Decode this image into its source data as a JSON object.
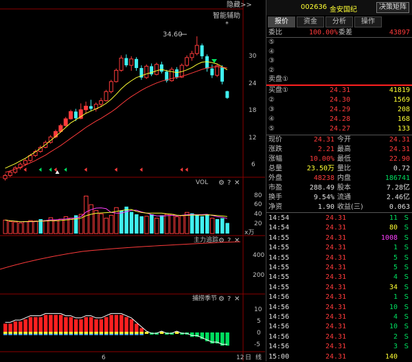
{
  "chart": {
    "top_button": "隐藏>>",
    "annotation": "智能辅助",
    "annotation_star": "*",
    "price_high_label": "34.60",
    "price_axis": [
      "30",
      "24",
      "18",
      "12",
      "6"
    ],
    "vol_title": "VOL",
    "vol_axis": [
      "80",
      "60",
      "40",
      "20"
    ],
    "vol_unit": "x万",
    "main_title": "主力追踪",
    "main_axis": [
      "400",
      "200"
    ],
    "season_title": "捕捞季节",
    "season_axis": [
      "10",
      "5",
      "0",
      "-5"
    ],
    "bottom_left_label": "6",
    "bottom_right_label": "12",
    "period_day": "日",
    "period_line": "线",
    "candles": [
      {
        "o": 3.2,
        "c": 3.9,
        "h": 4.3,
        "l": 2.8
      },
      {
        "o": 3.9,
        "c": 4.6,
        "h": 5.0,
        "l": 3.6
      },
      {
        "o": 4.6,
        "c": 5.6,
        "h": 6.0,
        "l": 4.3
      },
      {
        "o": 5.6,
        "c": 6.4,
        "h": 6.8,
        "l": 5.2
      },
      {
        "o": 6.4,
        "c": 7.2,
        "h": 7.6,
        "l": 6.0
      },
      {
        "o": 7.2,
        "c": 8.3,
        "h": 8.7,
        "l": 6.9
      },
      {
        "o": 8.3,
        "c": 9.2,
        "h": 9.6,
        "l": 8.0
      },
      {
        "o": 9.2,
        "c": 10.1,
        "h": 10.5,
        "l": 8.9
      },
      {
        "o": 10.1,
        "c": 11.2,
        "h": 11.6,
        "l": 9.9
      },
      {
        "o": 11.2,
        "c": 12.4,
        "h": 12.8,
        "l": 10.9
      },
      {
        "o": 12.4,
        "c": 13.6,
        "h": 14.0,
        "l": 12.1
      },
      {
        "o": 13.6,
        "c": 14.9,
        "h": 15.3,
        "l": 13.3
      },
      {
        "o": 14.9,
        "c": 16.4,
        "h": 16.8,
        "l": 14.7
      },
      {
        "o": 16.4,
        "c": 18.0,
        "h": 18.4,
        "l": 16.2
      },
      {
        "o": 18.0,
        "c": 16.5,
        "h": 18.6,
        "l": 15.9
      },
      {
        "o": 16.5,
        "c": 18.4,
        "h": 19.8,
        "l": 16.3
      },
      {
        "o": 18.4,
        "c": 19.2,
        "h": 20.2,
        "l": 17.6
      },
      {
        "o": 19.2,
        "c": 18.6,
        "h": 20.6,
        "l": 18.2
      },
      {
        "o": 18.6,
        "c": 19.6,
        "h": 20.0,
        "l": 18.0
      },
      {
        "o": 19.6,
        "c": 20.4,
        "h": 21.0,
        "l": 19.0
      },
      {
        "o": 20.4,
        "c": 22.4,
        "h": 22.8,
        "l": 20.2
      },
      {
        "o": 22.4,
        "c": 24.6,
        "h": 25.0,
        "l": 22.0
      },
      {
        "o": 24.6,
        "c": 27.1,
        "h": 27.5,
        "l": 24.4
      },
      {
        "o": 27.1,
        "c": 29.8,
        "h": 30.4,
        "l": 26.8
      },
      {
        "o": 29.8,
        "c": 28.2,
        "h": 30.6,
        "l": 27.8
      },
      {
        "o": 28.2,
        "c": 29.6,
        "h": 30.2,
        "l": 27.0
      },
      {
        "o": 29.6,
        "c": 27.6,
        "h": 30.0,
        "l": 27.0
      },
      {
        "o": 27.6,
        "c": 25.5,
        "h": 28.2,
        "l": 25.0
      },
      {
        "o": 25.5,
        "c": 28.0,
        "h": 28.4,
        "l": 25.2
      },
      {
        "o": 28.0,
        "c": 26.2,
        "h": 28.6,
        "l": 25.8
      },
      {
        "o": 26.2,
        "c": 28.4,
        "h": 28.8,
        "l": 26.0
      },
      {
        "o": 28.4,
        "c": 26.8,
        "h": 29.0,
        "l": 26.4
      },
      {
        "o": 26.8,
        "c": 24.8,
        "h": 27.2,
        "l": 24.4
      },
      {
        "o": 24.8,
        "c": 27.3,
        "h": 27.8,
        "l": 24.6
      },
      {
        "o": 27.3,
        "c": 25.6,
        "h": 27.8,
        "l": 25.2
      },
      {
        "o": 25.6,
        "c": 28.2,
        "h": 28.6,
        "l": 25.4
      },
      {
        "o": 28.2,
        "c": 29.9,
        "h": 30.4,
        "l": 27.9
      },
      {
        "o": 29.9,
        "c": 30.8,
        "h": 31.4,
        "l": 29.2
      },
      {
        "o": 30.8,
        "c": 32.6,
        "h": 34.6,
        "l": 30.4
      },
      {
        "o": 32.6,
        "c": 30.2,
        "h": 33.0,
        "l": 29.6
      },
      {
        "o": 30.2,
        "c": 27.5,
        "h": 30.6,
        "l": 26.8
      },
      {
        "o": 27.5,
        "c": 26.0,
        "h": 28.4,
        "l": 25.4
      },
      {
        "o": 26.0,
        "c": 28.1,
        "h": 28.6,
        "l": 25.6
      },
      {
        "o": 27.8,
        "c": 24.6,
        "h": 28.2,
        "l": 24.0
      },
      {
        "o": 22.5,
        "c": 21.0,
        "h": 22.6,
        "l": 20.8
      }
    ],
    "ma": [
      [
        5.5,
        6.0,
        6.5,
        7.1,
        7.7,
        8.4,
        9.1,
        9.9,
        10.7,
        11.6,
        12.5,
        13.5,
        14.5,
        15.5,
        16.2,
        16.9,
        17.6,
        18.1,
        18.6,
        19.1,
        19.8,
        20.7,
        21.8,
        23.0,
        24.0,
        24.8,
        25.5,
        25.9,
        26.3,
        26.6,
        27.0,
        27.3,
        27.0,
        26.8,
        26.6,
        26.8,
        27.2,
        27.7,
        28.4,
        28.9,
        29.0,
        28.8,
        28.5,
        27.9,
        27.2
      ],
      [
        4.6,
        4.9,
        5.3,
        5.7,
        6.2,
        6.7,
        7.2,
        7.8,
        8.4,
        9.1,
        9.8,
        10.5,
        11.3,
        12.1,
        12.9,
        13.7,
        14.5,
        15.2,
        15.9,
        16.5,
        17.2,
        17.9,
        18.7,
        19.6,
        20.5,
        21.3,
        22.0,
        22.7,
        23.3,
        23.8,
        24.3,
        24.7,
        25.0,
        25.3,
        25.5,
        25.8,
        26.1,
        26.5,
        26.9,
        27.3,
        27.6,
        27.8,
        27.9,
        27.8,
        27.6
      ]
    ],
    "volumes": [
      {
        "v": 28,
        "up": true
      },
      {
        "v": 25,
        "up": true
      },
      {
        "v": 24,
        "up": true
      },
      {
        "v": 22,
        "up": true
      },
      {
        "v": 25,
        "up": true
      },
      {
        "v": 27,
        "up": true
      },
      {
        "v": 26,
        "up": true
      },
      {
        "v": 30,
        "up": false
      },
      {
        "v": 27,
        "up": true
      },
      {
        "v": 33,
        "up": true
      },
      {
        "v": 27,
        "up": true
      },
      {
        "v": 30,
        "up": true
      },
      {
        "v": 35,
        "up": true
      },
      {
        "v": 32,
        "up": true
      },
      {
        "v": 38,
        "up": false
      },
      {
        "v": 40,
        "up": true
      },
      {
        "v": 78,
        "up": true
      },
      {
        "v": 60,
        "up": true
      },
      {
        "v": 48,
        "up": true
      },
      {
        "v": 41,
        "up": true
      },
      {
        "v": 32,
        "up": true
      },
      {
        "v": 38,
        "up": true
      },
      {
        "v": 54,
        "up": true
      },
      {
        "v": 48,
        "up": false
      },
      {
        "v": 56,
        "up": false
      },
      {
        "v": 45,
        "up": false
      },
      {
        "v": 40,
        "up": false
      },
      {
        "v": 36,
        "up": false
      },
      {
        "v": 36,
        "up": true
      },
      {
        "v": 40,
        "up": false
      },
      {
        "v": 32,
        "up": true
      },
      {
        "v": 38,
        "up": false
      },
      {
        "v": 40,
        "up": true
      },
      {
        "v": 40,
        "up": true
      },
      {
        "v": 35,
        "up": true
      },
      {
        "v": 37,
        "up": true
      },
      {
        "v": 44,
        "up": true
      },
      {
        "v": 42,
        "up": false
      },
      {
        "v": 38,
        "up": false
      },
      {
        "v": 36,
        "up": false
      },
      {
        "v": 40,
        "up": false
      },
      {
        "v": 32,
        "up": true
      },
      {
        "v": 30,
        "up": false
      },
      {
        "v": 32,
        "up": false
      },
      {
        "v": 22,
        "up": false
      }
    ],
    "season": [
      4,
      4,
      5,
      5,
      6,
      7,
      7,
      7,
      8,
      8,
      8,
      8,
      7,
      7,
      6,
      6,
      7,
      7,
      6,
      6,
      7,
      8,
      8,
      8,
      7,
      6,
      4,
      2,
      0,
      -1,
      -1,
      0,
      -1,
      -1,
      0,
      -1,
      -1,
      -2,
      -2,
      -3,
      -4,
      -5,
      -5,
      -6,
      -6
    ]
  },
  "header": {
    "code": "002636",
    "name": "金安国纪",
    "button": "决策矩阵"
  },
  "tabs": [
    "报价",
    "资金",
    "分析",
    "操作"
  ],
  "bid_ratio": {
    "label1": "委比",
    "value1": "100.00%",
    "label2": "委差",
    "value2": "43897"
  },
  "sell_orders": [
    {
      "label": "⑤",
      "price": "",
      "vol": ""
    },
    {
      "label": "④",
      "price": "",
      "vol": ""
    },
    {
      "label": "③",
      "price": "",
      "vol": ""
    },
    {
      "label": "②",
      "price": "",
      "vol": ""
    },
    {
      "label": "卖盘①",
      "price": "",
      "vol": ""
    }
  ],
  "buy_orders": [
    {
      "label": "买盘①",
      "price": "24.31",
      "vol": "41819"
    },
    {
      "label": "②",
      "price": "24.30",
      "vol": "1569"
    },
    {
      "label": "③",
      "price": "24.29",
      "vol": "208"
    },
    {
      "label": "④",
      "price": "24.28",
      "vol": "168"
    },
    {
      "label": "⑤",
      "price": "24.27",
      "vol": "133"
    }
  ],
  "quote": [
    {
      "l1": "现价",
      "v1": "24.31",
      "c1": "red",
      "l2": "今开",
      "v2": "24.31",
      "c2": "red"
    },
    {
      "l1": "涨跌",
      "v1": "2.21",
      "c1": "red",
      "l2": "最高",
      "v2": "24.31",
      "c2": "red"
    },
    {
      "l1": "涨幅",
      "v1": "10.00%",
      "c1": "red",
      "l2": "最低",
      "v2": "22.90",
      "c2": "red"
    },
    {
      "l1": "总量",
      "v1": "23.50万",
      "c1": "yellow",
      "l2": "量比",
      "v2": "0.72",
      "c2": "white"
    },
    {
      "l1": "外盘",
      "v1": "48238",
      "c1": "red",
      "l2": "内盘",
      "v2": "186741",
      "c2": "green"
    },
    {
      "l1": "市盈",
      "v1": "288.49",
      "c1": "white",
      "l2": "股本",
      "v2": "7.28亿",
      "c2": "white"
    },
    {
      "l1": "换手",
      "v1": "9.54%",
      "c1": "white",
      "l2": "流通",
      "v2": "2.46亿",
      "c2": "white"
    },
    {
      "l1": "净资",
      "v1": "1.90",
      "c1": "white",
      "l2": "收益(三)",
      "v2": "0.063",
      "c2": "white"
    }
  ],
  "ticks": [
    {
      "time": "14:54",
      "price": "24.31",
      "vol": "11",
      "vc": "green",
      "flag": "S"
    },
    {
      "time": "14:54",
      "price": "24.31",
      "vol": "80",
      "vc": "yellow",
      "flag": "S"
    },
    {
      "time": "14:55",
      "price": "24.31",
      "vol": "1008",
      "vc": "magenta",
      "flag": "S"
    },
    {
      "time": "14:55",
      "price": "24.31",
      "vol": "1",
      "vc": "green",
      "flag": "S"
    },
    {
      "time": "14:55",
      "price": "24.31",
      "vol": "5",
      "vc": "green",
      "flag": "S"
    },
    {
      "time": "14:55",
      "price": "24.31",
      "vol": "5",
      "vc": "green",
      "flag": "S"
    },
    {
      "time": "14:55",
      "price": "24.31",
      "vol": "4",
      "vc": "green",
      "flag": "S"
    },
    {
      "time": "14:55",
      "price": "24.31",
      "vol": "34",
      "vc": "yellow",
      "flag": "S"
    },
    {
      "time": "14:56",
      "price": "24.31",
      "vol": "1",
      "vc": "green",
      "flag": "S"
    },
    {
      "time": "14:56",
      "price": "24.31",
      "vol": "10",
      "vc": "green",
      "flag": "S"
    },
    {
      "time": "14:56",
      "price": "24.31",
      "vol": "4",
      "vc": "green",
      "flag": "S"
    },
    {
      "time": "14:56",
      "price": "24.31",
      "vol": "10",
      "vc": "green",
      "flag": "S"
    },
    {
      "time": "14:56",
      "price": "24.31",
      "vol": "2",
      "vc": "green",
      "flag": "S"
    },
    {
      "time": "14:56",
      "price": "24.31",
      "vol": "3",
      "vc": "green",
      "flag": "S"
    },
    {
      "time": "15:00",
      "price": "24.31",
      "vol": "140",
      "vc": "yellow",
      "flag": ""
    }
  ]
}
